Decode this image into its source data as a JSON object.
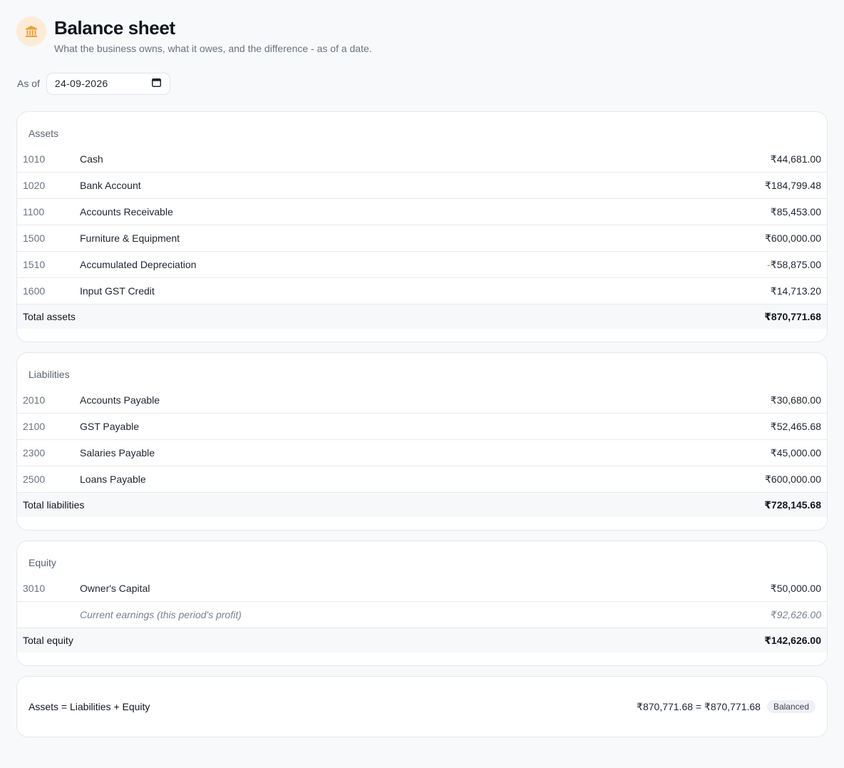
{
  "header": {
    "title": "Balance sheet",
    "subtitle": "What the business owns, what it owes, and the difference - as of a date.",
    "icon": "bank-icon"
  },
  "asof": {
    "label": "As of",
    "date_value": "24-09-2026",
    "icon": "calendar-icon"
  },
  "assets": {
    "title": "Assets",
    "rows": [
      {
        "code": "1010",
        "name": "Cash",
        "amount": "₹44,681.00"
      },
      {
        "code": "1020",
        "name": "Bank Account",
        "amount": "₹184,799.48"
      },
      {
        "code": "1100",
        "name": "Accounts Receivable",
        "amount": "₹85,453.00"
      },
      {
        "code": "1500",
        "name": "Furniture & Equipment",
        "amount": "₹600,000.00"
      },
      {
        "code": "1510",
        "name": "Accumulated Depreciation",
        "amount_sign": "-",
        "amount": "₹58,875.00"
      },
      {
        "code": "1600",
        "name": "Input GST Credit",
        "amount": "₹14,713.20"
      }
    ],
    "total_label": "Total assets",
    "total_amount": "₹870,771.68"
  },
  "liabilities": {
    "title": "Liabilities",
    "rows": [
      {
        "code": "2010",
        "name": "Accounts Payable",
        "amount": "₹30,680.00"
      },
      {
        "code": "2100",
        "name": "GST Payable",
        "amount": "₹52,465.68"
      },
      {
        "code": "2300",
        "name": "Salaries Payable",
        "amount": "₹45,000.00"
      },
      {
        "code": "2500",
        "name": "Loans Payable",
        "amount": "₹600,000.00"
      }
    ],
    "total_label": "Total liabilities",
    "total_amount": "₹728,145.68"
  },
  "equity": {
    "title": "Equity",
    "rows": [
      {
        "code": "3010",
        "name": "Owner's Capital",
        "amount": "₹50,000.00"
      }
    ],
    "current_earnings_label": "Current earnings (this period's profit)",
    "current_earnings_amount": "₹92,626.00",
    "total_label": "Total equity",
    "total_amount": "₹142,626.00"
  },
  "summary": {
    "equation": "Assets = Liabilities + Equity",
    "comparison": "₹870,771.68 = ₹870,771.68",
    "status": "Balanced"
  },
  "colors": {
    "accent_icon_bg": "#fdebd7",
    "accent_icon": "#e9a23b",
    "negative_sign": "#e07a3c"
  }
}
